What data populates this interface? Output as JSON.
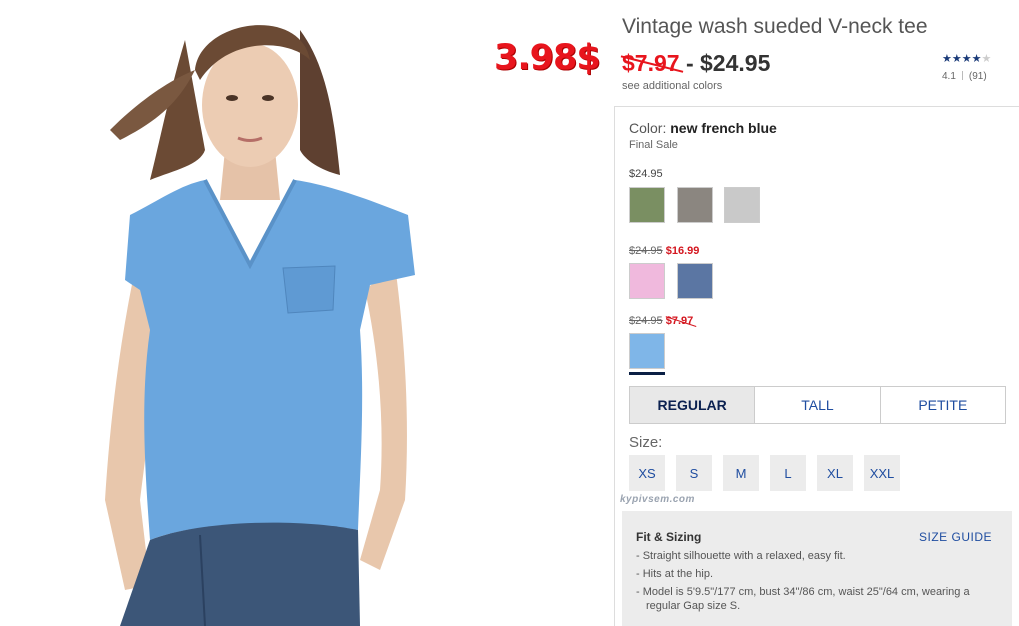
{
  "product": {
    "title": "Vintage wash sueded V-neck tee",
    "promo_price": "3.98$",
    "price_old": "$7.97",
    "price_sep": " - ",
    "price_new": "$24.95",
    "see_colors": "see additional colors"
  },
  "rating": {
    "stars_on": "★★★★",
    "stars_off": "★",
    "value": "4.1",
    "count": "(91)",
    "score": 4.1
  },
  "color": {
    "label": "Color: ",
    "name": "new french blue",
    "final_sale": "Final Sale"
  },
  "swatch_groups": [
    {
      "price": "$24.95",
      "swatches": [
        "#7a8f62",
        "#8b8680",
        "#c9c9c9"
      ]
    },
    {
      "price_old": "$24.95",
      "price_sale": "$16.99",
      "swatches": [
        "#f0b9dd",
        "#5b76a3"
      ]
    },
    {
      "price_old": "$24.95",
      "price_sale": "$7.97",
      "swatches": [
        "#7fb6e8"
      ]
    }
  ],
  "fits": [
    "REGULAR",
    "TALL",
    "PETITE"
  ],
  "size_label": "Size:",
  "sizes": [
    "XS",
    "S",
    "M",
    "L",
    "XL",
    "XXL"
  ],
  "watermark": "kypivsem.com",
  "fit_sizing": {
    "title": "Fit & Sizing",
    "guide": "SIZE GUIDE",
    "items": [
      "- Straight silhouette with a relaxed, easy fit.",
      "- Hits at the hip.",
      "- Model is 5'9.5\"/177 cm, bust 34\"/86 cm, waist 25\"/64 cm, wearing a regular Gap size S."
    ]
  },
  "colors": {
    "promo": "#e8151d",
    "sale": "#d4161f",
    "link": "#1f4da0",
    "star": "#1a3a78",
    "tee": "#6aa6de"
  }
}
